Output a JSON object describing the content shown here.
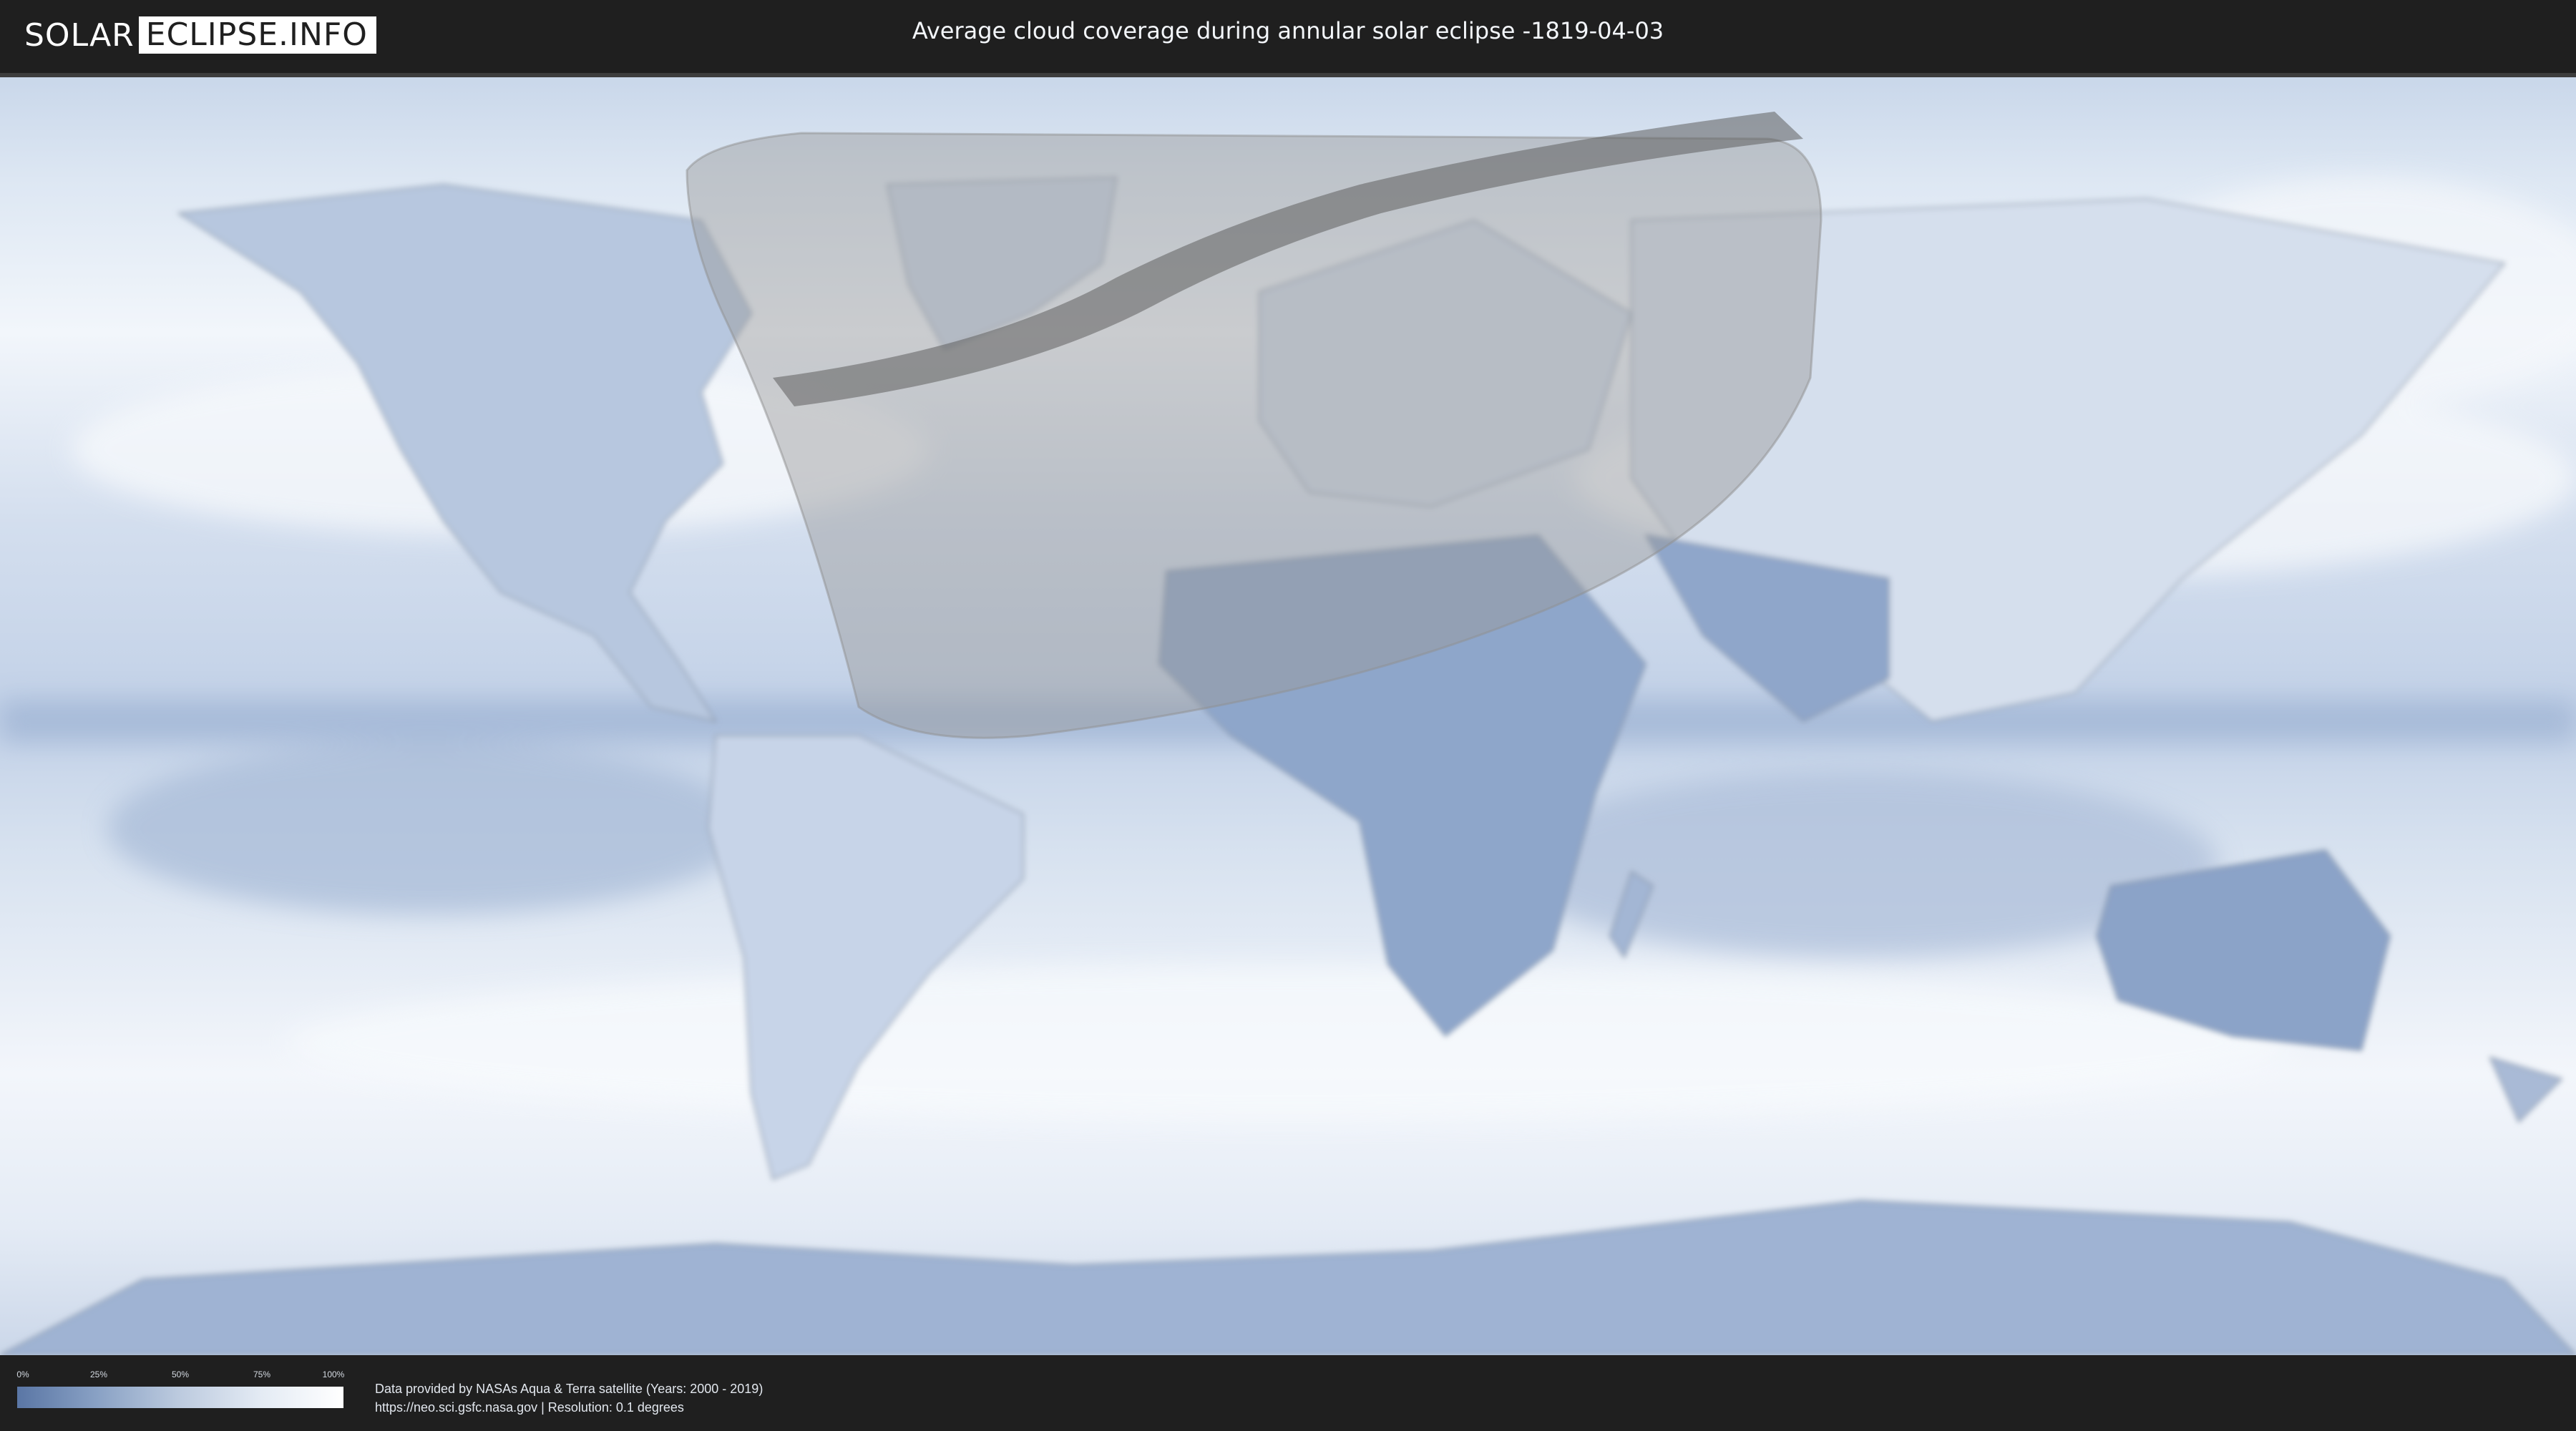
{
  "header": {
    "logo_left": "SOLAR",
    "logo_right": "ECLIPSE.INFO",
    "title": "Average cloud coverage during annular solar eclipse -1819-04-03"
  },
  "map": {
    "colors": {
      "ocean_cloud_low": "#7e9bc6",
      "cloud_high": "#ffffff",
      "eclipse_zone": "#b8b8b8",
      "annular_path": "#6f6f6f"
    }
  },
  "legend": {
    "ticks": [
      "0%",
      "25%",
      "50%",
      "75%",
      "100%"
    ]
  },
  "source": {
    "line1": "Data provided by NASAs Aqua & Terra satellite (Years: 2000 - 2019)",
    "line2": "https://neo.sci.gsfc.nasa.gov | Resolution: 0.1 degrees"
  }
}
